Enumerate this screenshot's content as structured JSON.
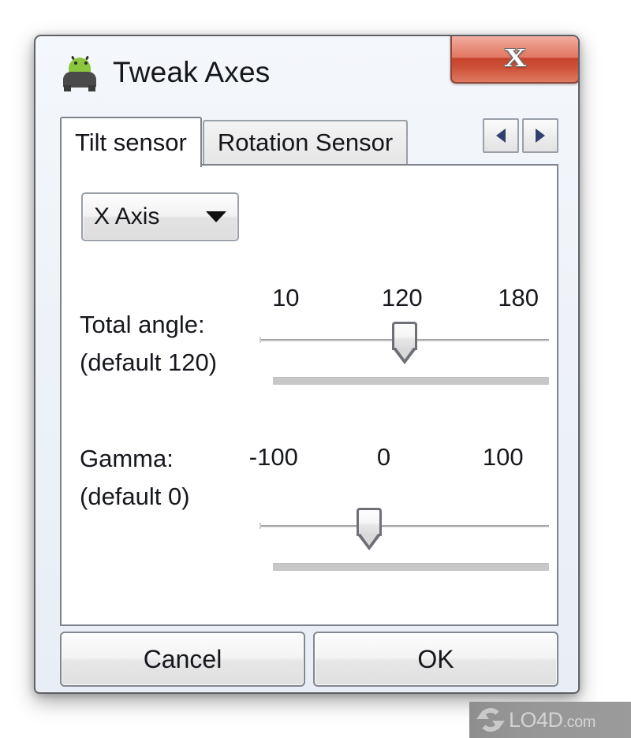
{
  "window": {
    "title": "Tweak Axes",
    "icon": "android-car-icon",
    "close_label": "X"
  },
  "tabs": [
    {
      "label": "Tilt sensor",
      "active": true
    },
    {
      "label": "Rotation Sensor",
      "active": false
    }
  ],
  "tab_nav": {
    "prev_icon": "chevron-left-icon",
    "next_icon": "chevron-right-icon"
  },
  "axis_select": {
    "value": "X Axis",
    "caret_icon": "chevron-down-icon"
  },
  "sliders": [
    {
      "id": "total-angle",
      "label_line1": "Total angle:",
      "label_line2": "(default 120)",
      "ticks": [
        "10",
        "120",
        "180"
      ],
      "min": 10,
      "max": 180,
      "value": 120,
      "thumb_percent": 50
    },
    {
      "id": "gamma",
      "label_line1": "Gamma:",
      "label_line2": "(default 0)",
      "ticks": [
        "-100",
        "0",
        "100"
      ],
      "min": -100,
      "max": 100,
      "value": 0,
      "thumb_percent": 38
    }
  ],
  "footer": {
    "cancel_label": "Cancel",
    "ok_label": "OK"
  },
  "watermark": {
    "brand": "LO4D",
    "suffix": ".com",
    "logo": "refresh-circle-icon"
  }
}
